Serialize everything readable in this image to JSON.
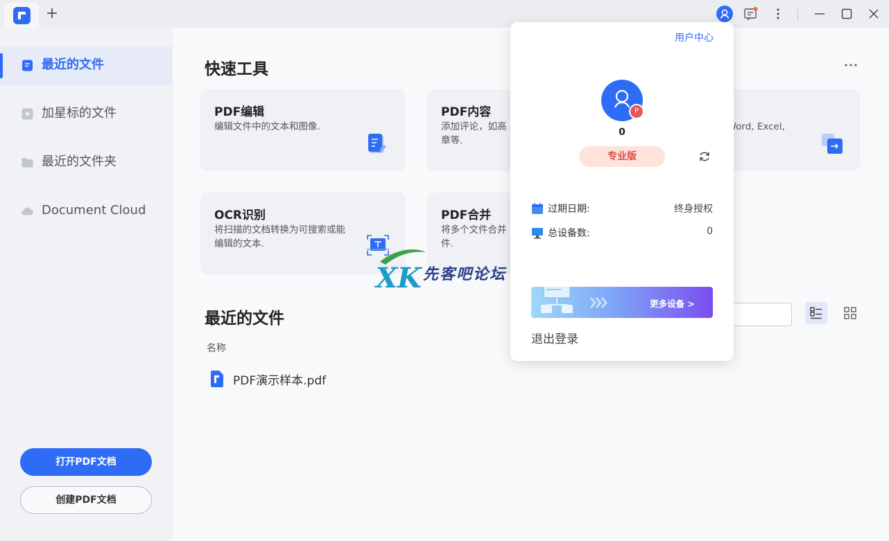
{
  "titlebar": {
    "new_tab": "+",
    "icons": [
      "app-logo",
      "user-icon",
      "message-icon",
      "more-vertical-icon",
      "minimize-icon",
      "maximize-icon",
      "close-icon"
    ]
  },
  "sidebar": {
    "items": [
      {
        "label": "最近的文件",
        "icon": "document-icon",
        "active": true
      },
      {
        "label": "加星标的文件",
        "icon": "star-icon",
        "active": false
      },
      {
        "label": "最近的文件夹",
        "icon": "folder-icon",
        "active": false
      },
      {
        "label": "Document Cloud",
        "icon": "cloud-icon",
        "active": false
      }
    ],
    "open_button": "打开PDF文档",
    "create_button": "创建PDF文档"
  },
  "quick_tools": {
    "title": "快速工具",
    "cards": [
      {
        "title": "PDF编辑",
        "desc": "编辑文件中的文本和图像.",
        "icon": "edit-doc-icon"
      },
      {
        "title": "PDF内容",
        "desc": "添加评论，如高\n章等.",
        "icon": "comment-icon"
      },
      {
        "title": "",
        "desc": "gWord, Excel,",
        "icon": "convert-icon"
      },
      {
        "title": "OCR识别",
        "desc": "将扫描的文档转换为可搜索或能编辑的文本.",
        "icon": "ocr-scan-icon"
      },
      {
        "title": "PDF合并",
        "desc": "将多个文件合并\n件.",
        "icon": "merge-icon"
      }
    ]
  },
  "recent_files": {
    "title": "最近的文件",
    "column_name": "名称",
    "files": [
      {
        "name": "PDF演示样本.pdf"
      }
    ]
  },
  "watermark": {
    "logo": "XK",
    "text": "先客吧论坛"
  },
  "user_popup": {
    "user_center": "用户中心",
    "username": "0",
    "badge": "P",
    "edition": "专业版",
    "expire_label": "过期日期:",
    "expire_value": "终身授权",
    "devices_label": "总设备数:",
    "devices_value": "0",
    "banner_text": "更多设备 >",
    "logout": "退出登录"
  },
  "colors": {
    "accent": "#2f6cf5",
    "edition_bg": "#fde3dc",
    "edition_text": "#d84c45",
    "badge": "#e5575b"
  }
}
